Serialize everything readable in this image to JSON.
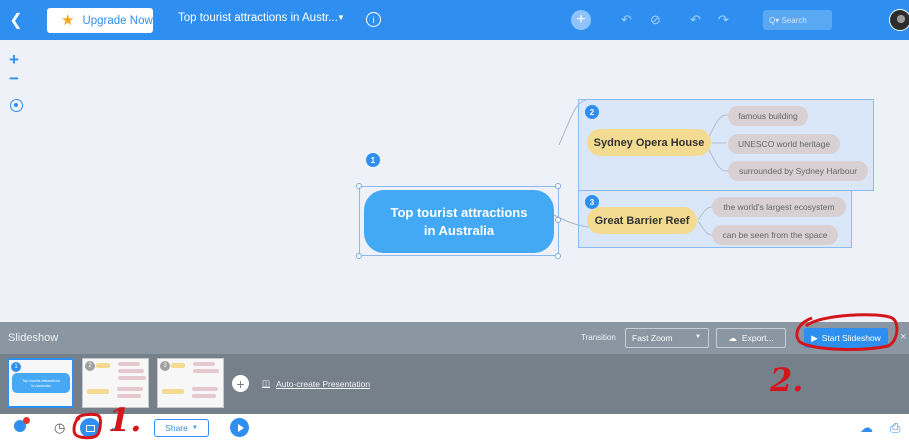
{
  "topbar": {
    "upgrade_label": "Upgrade Now",
    "document_title": "Top tourist attractions in Austr...",
    "search_placeholder": "Q▾ Search",
    "icons": [
      "back-icon",
      "star-icon",
      "chevron-down-icon",
      "info-icon",
      "add-icon",
      "route-icon",
      "ban-icon",
      "undo-icon",
      "redo-icon",
      "search-icon",
      "avatar"
    ]
  },
  "zoom": {
    "in_label": "+",
    "out_label": "−"
  },
  "mindmap": {
    "root": {
      "number": "1",
      "label_line1": "Top tourist attractions",
      "label_line2": "in Australia"
    },
    "topics": [
      {
        "number": "2",
        "label": "Sydney Opera House",
        "subtopics": [
          "famous building",
          "UNESCO world heritage",
          "surrounded by Sydney Harbour"
        ]
      },
      {
        "number": "3",
        "label": "Great Barrier Reef",
        "subtopics": [
          "the world's largest ecosystem",
          "can be seen from the space"
        ]
      }
    ]
  },
  "slideshow": {
    "title": "Slideshow",
    "transition_label": "Transition",
    "transition_value": "Fast Zoom",
    "export_label": "Export...",
    "start_label": "Start Slideshow",
    "close_label": "×",
    "slides": [
      {
        "number": "1",
        "root_line1": "Top tourist attractions",
        "root_line2": "in Australia"
      },
      {
        "number": "2"
      },
      {
        "number": "3"
      }
    ],
    "add_label": "+",
    "autocreate_label": "Auto-create Presentation"
  },
  "bottombar": {
    "share_label": "Share",
    "icons": [
      "bug-icon",
      "history-icon",
      "present-icon",
      "check-icon",
      "play-icon",
      "cloud-icon",
      "print-icon"
    ]
  },
  "annotations": {
    "label_1": "1.",
    "label_2": "2."
  },
  "colors": {
    "accent": "#2f8ff0",
    "topic": "#f3dc91",
    "subtopic": "#d9d0d3",
    "annotation": "#d4161a",
    "panel": "#8a96a1"
  }
}
